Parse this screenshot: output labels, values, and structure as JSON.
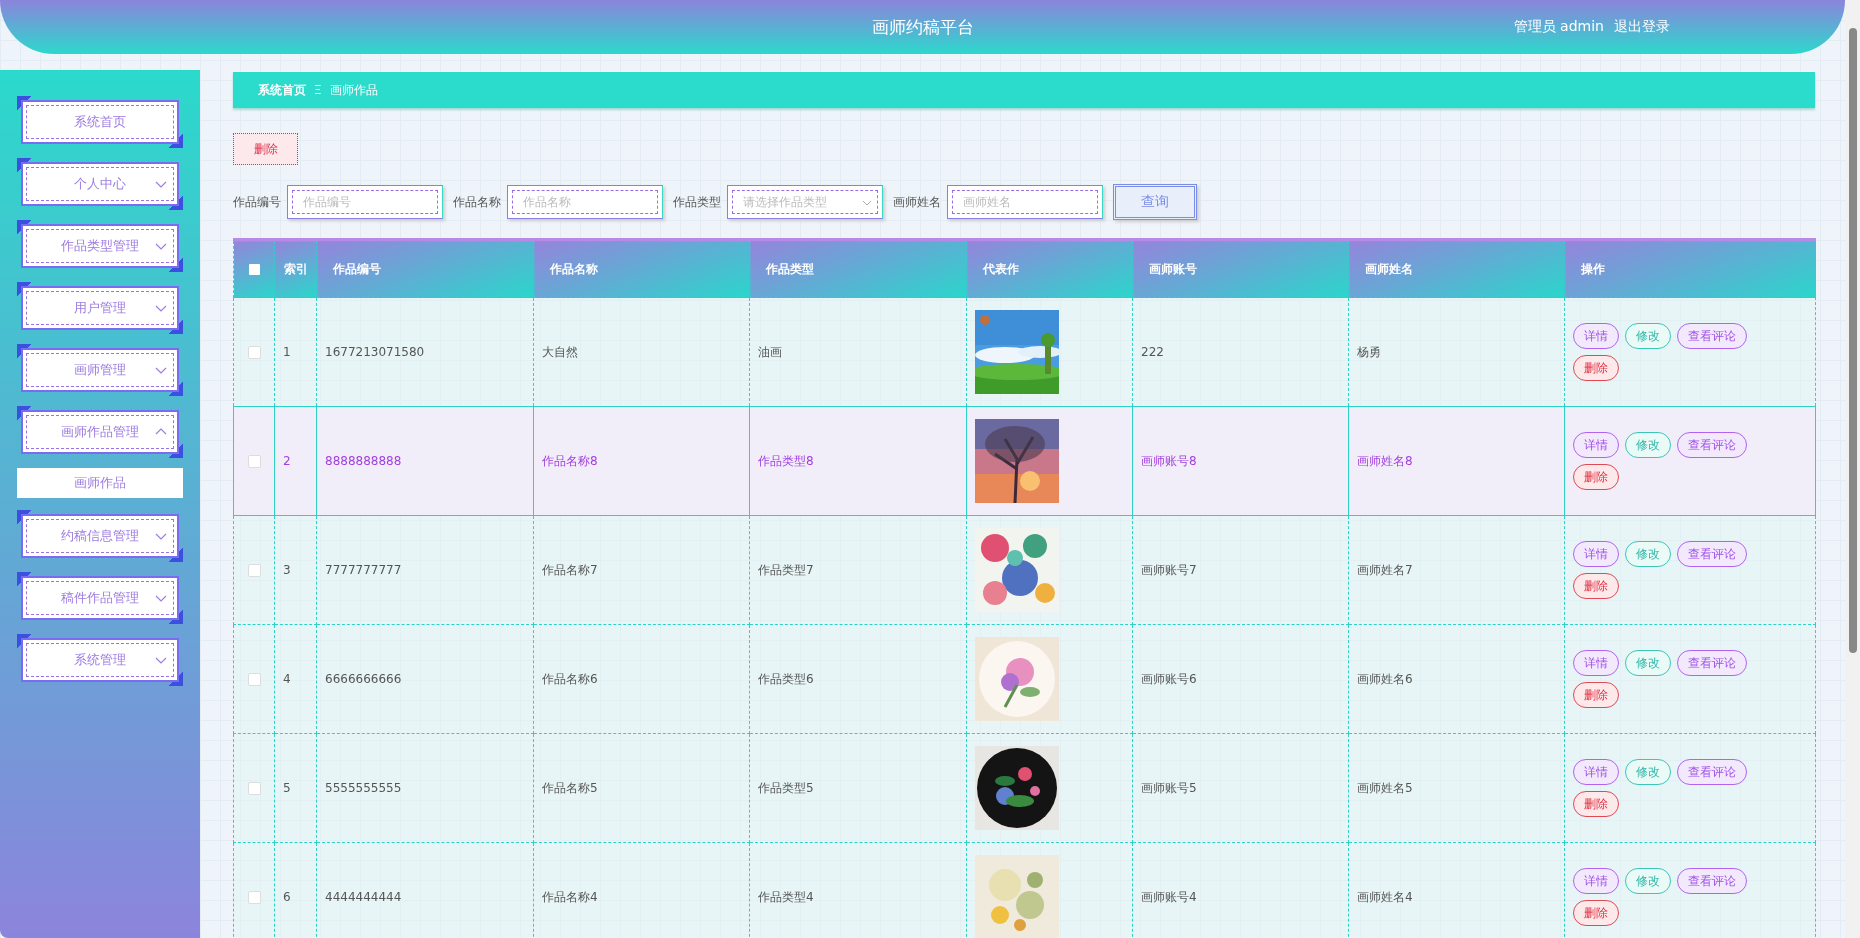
{
  "header": {
    "title": "画师约稿平台",
    "user": "管理员 admin",
    "logout": "退出登录"
  },
  "sidebar": {
    "items": [
      {
        "label": "系统首页",
        "kind": "link"
      },
      {
        "label": "个人中心",
        "kind": "menu",
        "expanded": false
      },
      {
        "label": "作品类型管理",
        "kind": "menu",
        "expanded": false
      },
      {
        "label": "用户管理",
        "kind": "menu",
        "expanded": false
      },
      {
        "label": "画师管理",
        "kind": "menu",
        "expanded": false
      },
      {
        "label": "画师作品管理",
        "kind": "menu",
        "expanded": true,
        "children": [
          {
            "label": "画师作品",
            "selected": true
          }
        ]
      },
      {
        "label": "约稿信息管理",
        "kind": "menu",
        "expanded": false
      },
      {
        "label": "稿件作品管理",
        "kind": "menu",
        "expanded": false
      },
      {
        "label": "系统管理",
        "kind": "menu",
        "expanded": false
      }
    ]
  },
  "breadcrumb": {
    "items": [
      "系统首页",
      "画师作品"
    ],
    "separator": "Ξ"
  },
  "toolbar": {
    "delete_button": "删除"
  },
  "search": {
    "fields": [
      {
        "label": "作品编号",
        "placeholder": "作品编号",
        "kind": "input"
      },
      {
        "label": "作品名称",
        "placeholder": "作品名称",
        "kind": "input"
      },
      {
        "label": "作品类型",
        "placeholder": "请选择作品类型",
        "kind": "select"
      },
      {
        "label": "画师姓名",
        "placeholder": "画师姓名",
        "kind": "input"
      }
    ],
    "button": "查询"
  },
  "table": {
    "select_all": {
      "checked": false
    },
    "columns": [
      "索引",
      "作品编号",
      "作品名称",
      "作品类型",
      "代表作",
      "画师账号",
      "画师姓名",
      "操作"
    ],
    "rows": [
      {
        "checked": false,
        "selected": false,
        "index": "1",
        "number": "1677213071580",
        "name": "大自然",
        "type": "油画",
        "account": "222",
        "painter": "杨勇",
        "actions": [
          {
            "label": "详情",
            "kind": "detail"
          },
          {
            "label": "修改",
            "kind": "edit"
          },
          {
            "label": "查看评论",
            "kind": "comments"
          },
          {
            "label": "删除",
            "kind": "delete"
          }
        ]
      },
      {
        "checked": false,
        "selected": true,
        "index": "2",
        "number": "8888888888",
        "name": "作品名称8",
        "type": "作品类型8",
        "account": "画师账号8",
        "painter": "画师姓名8",
        "actions": [
          {
            "label": "详情",
            "kind": "detail"
          },
          {
            "label": "修改",
            "kind": "edit"
          },
          {
            "label": "查看评论",
            "kind": "comments"
          },
          {
            "label": "删除",
            "kind": "delete"
          }
        ]
      },
      {
        "checked": false,
        "selected": false,
        "index": "3",
        "number": "7777777777",
        "name": "作品名称7",
        "type": "作品类型7",
        "account": "画师账号7",
        "painter": "画师姓名7",
        "actions": [
          {
            "label": "详情",
            "kind": "detail"
          },
          {
            "label": "修改",
            "kind": "edit"
          },
          {
            "label": "查看评论",
            "kind": "comments"
          },
          {
            "label": "删除",
            "kind": "delete"
          }
        ]
      },
      {
        "checked": false,
        "selected": false,
        "index": "4",
        "number": "6666666666",
        "name": "作品名称6",
        "type": "作品类型6",
        "account": "画师账号6",
        "painter": "画师姓名6",
        "actions": [
          {
            "label": "详情",
            "kind": "detail"
          },
          {
            "label": "修改",
            "kind": "edit"
          },
          {
            "label": "查看评论",
            "kind": "comments"
          },
          {
            "label": "删除",
            "kind": "delete"
          }
        ]
      },
      {
        "checked": false,
        "selected": false,
        "index": "5",
        "number": "5555555555",
        "name": "作品名称5",
        "type": "作品类型5",
        "account": "画师账号5",
        "painter": "画师姓名5",
        "actions": [
          {
            "label": "详情",
            "kind": "detail"
          },
          {
            "label": "修改",
            "kind": "edit"
          },
          {
            "label": "查看评论",
            "kind": "comments"
          },
          {
            "label": "删除",
            "kind": "delete"
          }
        ]
      },
      {
        "checked": false,
        "selected": false,
        "index": "6",
        "number": "4444444444",
        "name": "作品名称4",
        "type": "作品类型4",
        "account": "画师账号4",
        "painter": "画师姓名4",
        "actions": [
          {
            "label": "详情",
            "kind": "detail"
          },
          {
            "label": "修改",
            "kind": "edit"
          },
          {
            "label": "查看评论",
            "kind": "comments"
          },
          {
            "label": "删除",
            "kind": "delete"
          }
        ]
      }
    ]
  }
}
